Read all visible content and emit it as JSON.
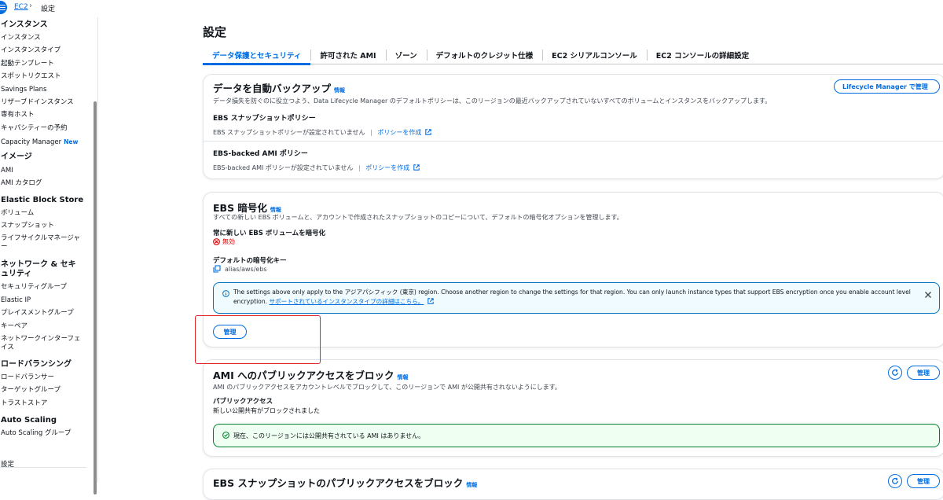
{
  "breadcrumb": {
    "root": "EC2",
    "current": "設定"
  },
  "sidebar": {
    "instances": {
      "title": "インスタンス",
      "items": [
        "インスタンス",
        "インスタンスタイプ",
        "起動テンプレート",
        "スポットリクエスト",
        "Savings Plans",
        "リザーブドインスタンス",
        "専有ホスト",
        "キャパシティーの予約",
        "Capacity Manager"
      ],
      "new_badge": "New"
    },
    "images": {
      "title": "イメージ",
      "items": [
        "AMI",
        "AMI カタログ"
      ]
    },
    "ebs": {
      "title": "Elastic Block Store",
      "items": [
        "ボリューム",
        "スナップショット",
        "ライフサイクルマネージャー"
      ]
    },
    "network": {
      "title": "ネットワーク & セキュリティ",
      "items": [
        "セキュリティグループ",
        "Elastic IP",
        "プレイスメントグループ",
        "キーペア",
        "ネットワークインターフェイス"
      ]
    },
    "lb": {
      "title": "ロードバランシング",
      "items": [
        "ロードバランサー",
        "ターゲットグループ",
        "トラストストア"
      ]
    },
    "autoscaling": {
      "title": "Auto Scaling",
      "items": [
        "Auto Scaling グループ"
      ]
    },
    "footer": "設定"
  },
  "page": {
    "title": "設定",
    "tabs": [
      "データ保護とセキュリティ",
      "許可された AMI",
      "ゾーン",
      "デフォルトのクレジット仕様",
      "EC2 シリアルコンソール",
      "EC2 コンソールの詳細設定"
    ]
  },
  "backup": {
    "title": "データを自動バックアップ",
    "info": "情報",
    "button": "Lifecycle Manager で管理",
    "description": "データ損失を防ぐのに役立つよう、Data Lifecycle Manager のデフォルトポリシーは、このリージョンの最近バックアップされていないすべてのボリュームとインスタンスをバックアップします。",
    "snapshot_heading": "EBS スナップショットポリシー",
    "snapshot_status": "EBS スナップショットポリシーが設定されていません",
    "snapshot_link": "ポリシーを作成",
    "ami_heading": "EBS-backed AMI ポリシー",
    "ami_status": "EBS-backed AMI ポリシーが設定されていません",
    "ami_link": "ポリシーを作成"
  },
  "encryption": {
    "title": "EBS 暗号化",
    "info": "情報",
    "description": "すべての新しい EBS ボリュームと、アカウントで作成されたスナップショットのコピーについて、デフォルトの暗号化オプションを管理します。",
    "always_heading": "常に新しい EBS ボリュームを暗号化",
    "always_value": "無効",
    "key_heading": "デフォルトの暗号化キー",
    "key_value": "alias/aws/ebs",
    "flash_text_1": "The settings above only apply to the アジアパシフィック (東京) region. Choose another region to change the settings for that region. You can only launch instance types that support EBS encryption once you enable account level",
    "flash_text_2": "encryption.",
    "flash_link": "サポートされているインスタンスタイプの詳細はこちら。",
    "manage_button": "管理"
  },
  "ami_public": {
    "title": "AMI へのパブリックアクセスをブロック",
    "info": "情報",
    "manage_button": "管理",
    "description": "AMI のパブリックアクセスをアカウントレベルでブロックして、このリージョンで AMI が公開共有されないようにします。",
    "access_heading": "パブリックアクセス",
    "access_value": "新しい公開共有がブロックされました",
    "success_text": "現在、このリージョンには公開共有されている AMI はありません。"
  },
  "snapshot_public": {
    "title": "EBS スナップショットのパブリックアクセスをブロック",
    "info": "情報",
    "manage_button": "管理"
  },
  "colors": {
    "accent": "#006ce0",
    "error": "#db0000",
    "success": "#00802f",
    "info_border": "#0073bb",
    "highlight": "#e02424"
  }
}
